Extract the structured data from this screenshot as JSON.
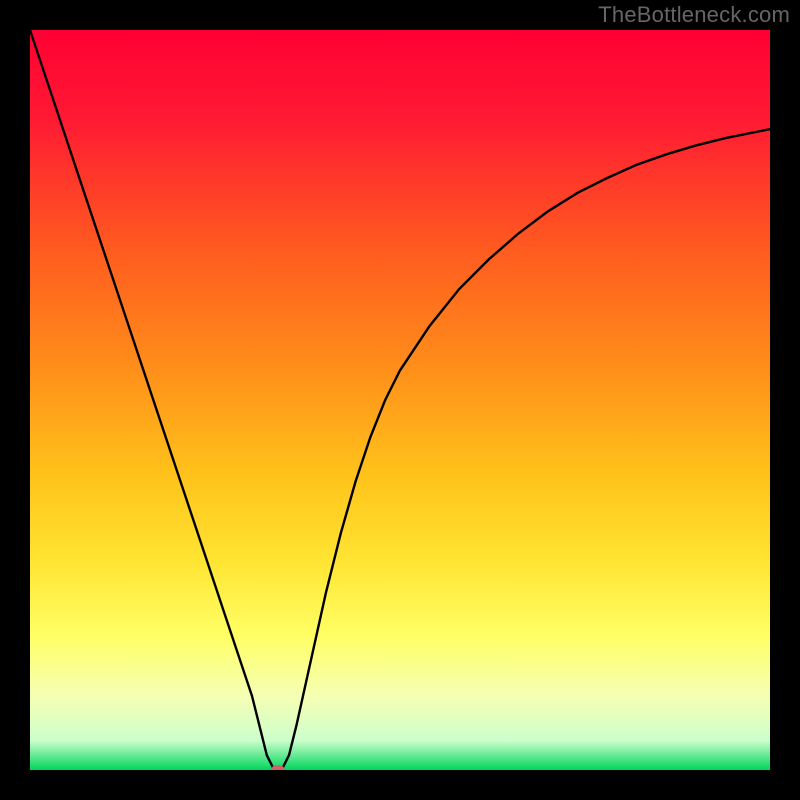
{
  "watermark": "TheBottleneck.com",
  "chart_data": {
    "type": "line",
    "title": "",
    "xlabel": "",
    "ylabel": "",
    "xlim": [
      0,
      100
    ],
    "ylim": [
      0,
      100
    ],
    "background": {
      "type": "vertical-gradient",
      "stops": [
        {
          "offset": 0.0,
          "color": "#ff0033"
        },
        {
          "offset": 0.12,
          "color": "#ff1a33"
        },
        {
          "offset": 0.3,
          "color": "#ff5c1f"
        },
        {
          "offset": 0.45,
          "color": "#ff8c1a"
        },
        {
          "offset": 0.6,
          "color": "#ffc21a"
        },
        {
          "offset": 0.72,
          "color": "#ffe533"
        },
        {
          "offset": 0.82,
          "color": "#ffff66"
        },
        {
          "offset": 0.9,
          "color": "#f5ffb3"
        },
        {
          "offset": 0.96,
          "color": "#ccffcc"
        },
        {
          "offset": 1.0,
          "color": "#00d65c"
        }
      ]
    },
    "series": [
      {
        "name": "bottleneck-curve",
        "color": "#000000",
        "x": [
          0,
          2,
          4,
          6,
          8,
          10,
          12,
          14,
          16,
          18,
          20,
          22,
          24,
          26,
          28,
          30,
          31,
          32,
          33,
          34,
          35,
          36,
          38,
          40,
          42,
          44,
          46,
          48,
          50,
          54,
          58,
          62,
          66,
          70,
          74,
          78,
          82,
          86,
          90,
          94,
          98,
          100
        ],
        "y": [
          100,
          94,
          88,
          82,
          76,
          70,
          64,
          58,
          52,
          46,
          40,
          34,
          28,
          22,
          16,
          10,
          6,
          2,
          0,
          0,
          2,
          6,
          15,
          24,
          32,
          39,
          45,
          50,
          54,
          60,
          65,
          69,
          72.5,
          75.5,
          78,
          80,
          81.8,
          83.2,
          84.4,
          85.4,
          86.2,
          86.6
        ]
      }
    ],
    "marker": {
      "name": "optimal-point",
      "x": 33.5,
      "y": 0,
      "color": "#cc6666",
      "shape": "ellipse",
      "rx": 7,
      "ry": 5
    }
  }
}
